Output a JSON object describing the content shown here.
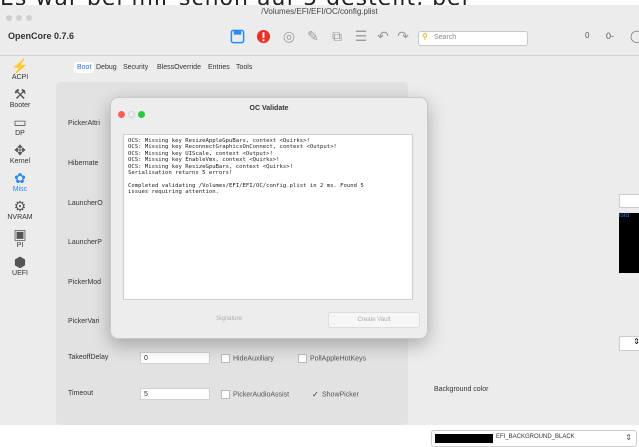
{
  "caption": {
    "text": "Es war bei mir schon auf 5 gestellt, bei"
  },
  "window": {
    "path": "/Volumes/EFI/EFI/OC/config.plist",
    "app_name": "OpenCore 0.7.6",
    "search_placeholder": "Search",
    "toolbar_right_value": "0",
    "toolbar_right_icon": "0-"
  },
  "sidebar": {
    "items": [
      {
        "label": "ACPI",
        "icon": "acpi-icon"
      },
      {
        "label": "Booter",
        "icon": "booter-icon"
      },
      {
        "label": "DP",
        "icon": "device-properties-icon"
      },
      {
        "label": "Kernel",
        "icon": "kernel-icon"
      },
      {
        "label": "Misc",
        "icon": "misc-icon",
        "active": true
      },
      {
        "label": "NVRAM",
        "icon": "nvram-icon"
      },
      {
        "label": "PI",
        "icon": "platform-info-icon"
      },
      {
        "label": "UEFI",
        "icon": "uefi-icon"
      }
    ]
  },
  "tabs": [
    "Boot",
    "Debug",
    "Security",
    "BlessOverride",
    "Entries",
    "Tools"
  ],
  "boot": {
    "labels": [
      "PickerAttri",
      "Hibernate",
      "LauncherO",
      "LauncherP",
      "PickerMod",
      "PickerVari"
    ],
    "takeoff_label": "TakeoffDelay",
    "takeoff_value": "0",
    "hideauxiliary": "HideAuxiliary",
    "pollapplehotkeys": "PollAppleHotKeys",
    "timeout_label": "Timeout",
    "timeout_value": "5",
    "pickeraudioassist": "PickerAudioAssist",
    "showpicker": "ShowPicker"
  },
  "right": {
    "background_color_label": "Background color",
    "background_color_value": "EFI_BACKGROUND_BLACK",
    "black_box_text": "lord"
  },
  "dialog": {
    "title": "OC Validate",
    "output": "OCS: Missing key ResizeAppleGpuBars, context <Quirks>!\nOCS: Missing key ReconnectGraphicsOnConnect, context <Output>!\nOCS: Missing key UIScale, context <Output>!\nOCS: Missing key EnableVmx, context <Quirks>!\nOCS: Missing key ResizeGpuBars, context <Quirks>!\nSerialisation returns 5 errors!\n\nCompleted validating /Volumes/EFI/EFI/OC/config.plist in 2 ms. Found 5\nissues requiring attention.",
    "signature_label": "Signature",
    "create_vault_label": "Create Vault"
  },
  "colors": {
    "accent": "#2b8bea",
    "close": "#ff5f57",
    "zoom": "#28c840",
    "warning": "#e8322b"
  }
}
